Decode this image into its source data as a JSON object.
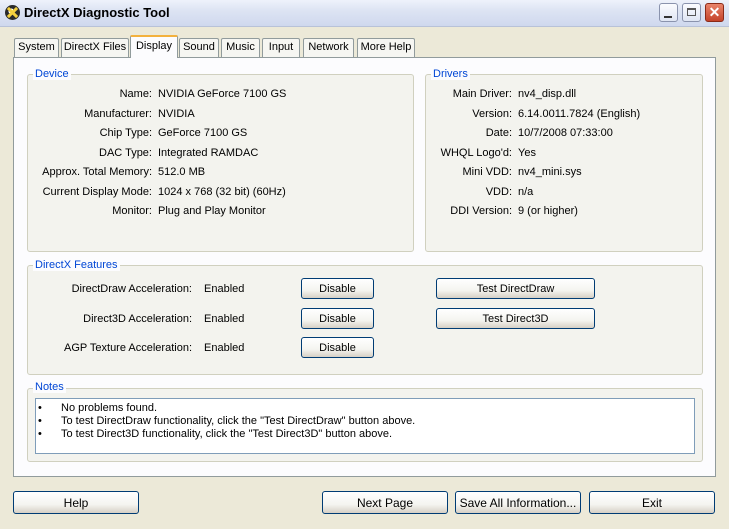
{
  "window": {
    "title": "DirectX Diagnostic Tool"
  },
  "tabs": [
    "System",
    "DirectX Files",
    "Display",
    "Sound",
    "Music",
    "Input",
    "Network",
    "More Help"
  ],
  "device": {
    "title": "Device",
    "rows": [
      {
        "label": "Name:",
        "value": "NVIDIA GeForce 7100 GS"
      },
      {
        "label": "Manufacturer:",
        "value": "NVIDIA"
      },
      {
        "label": "Chip Type:",
        "value": "GeForce 7100 GS"
      },
      {
        "label": "DAC Type:",
        "value": "Integrated RAMDAC"
      },
      {
        "label": "Approx. Total Memory:",
        "value": "512.0 MB"
      },
      {
        "label": "Current Display Mode:",
        "value": "1024 x 768 (32 bit) (60Hz)"
      },
      {
        "label": "Monitor:",
        "value": "Plug and Play Monitor"
      }
    ]
  },
  "drivers": {
    "title": "Drivers",
    "rows": [
      {
        "label": "Main Driver:",
        "value": "nv4_disp.dll"
      },
      {
        "label": "Version:",
        "value": "6.14.0011.7824 (English)"
      },
      {
        "label": "Date:",
        "value": "10/7/2008 07:33:00"
      },
      {
        "label": "WHQL Logo'd:",
        "value": "Yes"
      },
      {
        "label": "Mini VDD:",
        "value": "nv4_mini.sys"
      },
      {
        "label": "VDD:",
        "value": "n/a"
      },
      {
        "label": "DDI Version:",
        "value": "9 (or higher)"
      }
    ]
  },
  "features": {
    "title": "DirectX Features",
    "rows": [
      {
        "label": "DirectDraw Acceleration:",
        "status": "Enabled",
        "button": "Disable"
      },
      {
        "label": "Direct3D Acceleration:",
        "status": "Enabled",
        "button": "Disable"
      },
      {
        "label": "AGP Texture Acceleration:",
        "status": "Enabled",
        "button": "Disable"
      }
    ],
    "test_directdraw": "Test DirectDraw",
    "test_direct3d": "Test Direct3D"
  },
  "notes": {
    "title": "Notes",
    "lines": [
      "No problems found.",
      "To test DirectDraw functionality, click the \"Test DirectDraw\" button above.",
      "To test Direct3D functionality, click the \"Test Direct3D\" button above."
    ]
  },
  "bottom": {
    "help": "Help",
    "next_page": "Next Page",
    "save_all": "Save All Information...",
    "exit": "Exit"
  }
}
